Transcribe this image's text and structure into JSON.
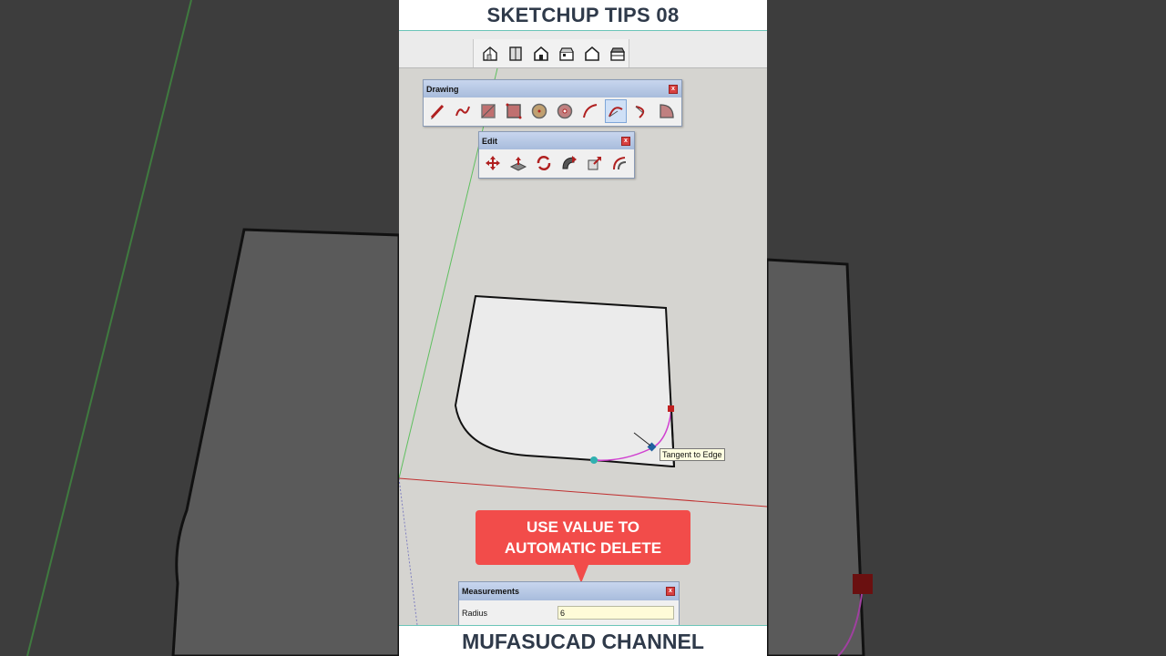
{
  "header": {
    "title": "SKETCHUP TIPS 08"
  },
  "footer": {
    "channel": "MUFASUCAD CHANNEL"
  },
  "views_toolbar": {
    "icons": [
      "iso-view-icon",
      "top-view-icon",
      "front-view-icon",
      "right-view-icon",
      "back-view-icon",
      "left-view-icon"
    ]
  },
  "drawing_panel": {
    "title": "Drawing",
    "close": "x",
    "tools": [
      "line-tool-icon",
      "freehand-tool-icon",
      "rectangle-tool-icon",
      "rotated-rectangle-tool-icon",
      "circle-tool-icon",
      "polygon-tool-icon",
      "arc-tool-icon",
      "two-point-arc-tool-icon",
      "three-point-arc-tool-icon",
      "pie-tool-icon"
    ],
    "active_tool": "two-point-arc-tool-icon"
  },
  "edit_panel": {
    "title": "Edit",
    "close": "x",
    "tools": [
      "move-tool-icon",
      "push-pull-tool-icon",
      "rotate-tool-icon",
      "follow-me-tool-icon",
      "scale-tool-icon",
      "offset-tool-icon"
    ]
  },
  "tooltip": {
    "text": "Tangent to Edge"
  },
  "callout": {
    "line1": "USE VALUE TO",
    "line2": "AUTOMATIC DELETE"
  },
  "measurements": {
    "title": "Measurements",
    "close": "x",
    "label": "Radius",
    "value": "6"
  },
  "colors": {
    "accent": "#f24c4a",
    "header_text": "#2f3a4a",
    "arc_magenta": "#d040d0",
    "axis_green": "#4caf50",
    "axis_red": "#c03030"
  }
}
